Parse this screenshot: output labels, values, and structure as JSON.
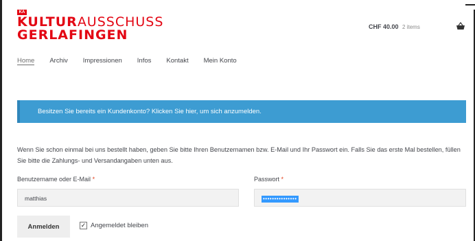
{
  "brand": {
    "mark": "KA",
    "line1_bold": "KULTUR",
    "line1_light": "AUSSCHUSS",
    "line2": "GERLAFINGEN",
    "color": "#e30613"
  },
  "cart": {
    "amount": "CHF 40.00",
    "count": "2 items",
    "icon": "basket-icon"
  },
  "nav": {
    "items": [
      "Home",
      "Archiv",
      "Impressionen",
      "Infos",
      "Kontakt",
      "Mein Konto"
    ],
    "active": "Home"
  },
  "notice": {
    "text": "Besitzen Sie bereits ein Kundenkonto? Klicken Sie hier, um sich anzumelden.",
    "color": "#3d9cd2"
  },
  "intro": "Wenn Sie schon einmal bei uns bestellt haben, geben Sie bitte Ihren Benutzernamen bzw. E-Mail und Ihr Passwort ein. Falls Sie das erste Mal bestellen, füllen Sie bitte die Zahlungs- und Versandangaben unten aus.",
  "form": {
    "username_label": "Benutzername oder E-Mail",
    "username_value": "matthias",
    "password_label": "Passwort",
    "password_value": "•••••••••••••••",
    "required_mark": "*",
    "login_button": "Anmelden",
    "remember_label": "Angemeldet bleiben",
    "remember_checked": "✓"
  }
}
